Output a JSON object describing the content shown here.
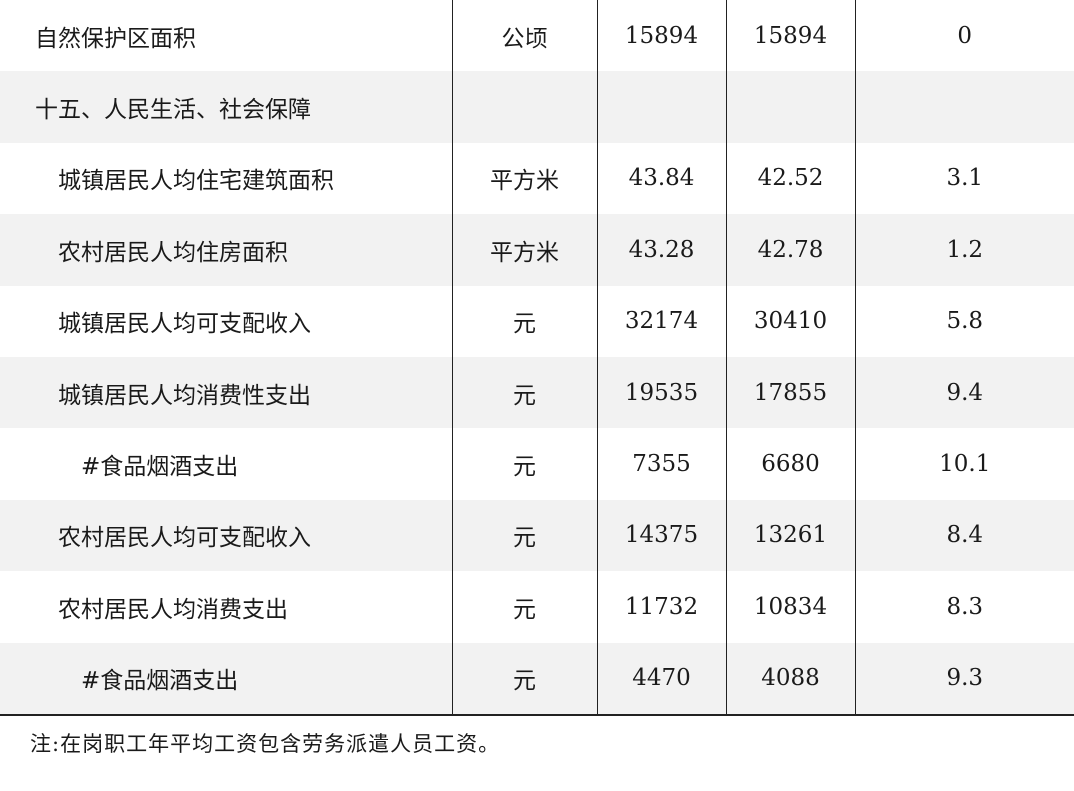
{
  "table": {
    "rows": [
      {
        "name": "自然保护区面积",
        "unit": "公顷",
        "v1": "15894",
        "v2": "15894",
        "v3": "0",
        "level": 0
      },
      {
        "name": "十五、人民生活、社会保障",
        "unit": "",
        "v1": "",
        "v2": "",
        "v3": "",
        "level": 0
      },
      {
        "name": "城镇居民人均住宅建筑面积",
        "unit": "平方米",
        "v1": "43.84",
        "v2": "42.52",
        "v3": "3.1",
        "level": 1
      },
      {
        "name": "农村居民人均住房面积",
        "unit": "平方米",
        "v1": "43.28",
        "v2": "42.78",
        "v3": "1.2",
        "level": 1
      },
      {
        "name": "城镇居民人均可支配收入",
        "unit": "元",
        "v1": "32174",
        "v2": "30410",
        "v3": "5.8",
        "level": 1
      },
      {
        "name": "城镇居民人均消费性支出",
        "unit": "元",
        "v1": "19535",
        "v2": "17855",
        "v3": "9.4",
        "level": 1
      },
      {
        "name": "#食品烟酒支出",
        "unit": "元",
        "v1": "7355",
        "v2": "6680",
        "v3": "10.1",
        "level": 2
      },
      {
        "name": "农村居民人均可支配收入",
        "unit": "元",
        "v1": "14375",
        "v2": "13261",
        "v3": "8.4",
        "level": 1
      },
      {
        "name": "农村居民人均消费支出",
        "unit": "元",
        "v1": "11732",
        "v2": "10834",
        "v3": "8.3",
        "level": 1
      },
      {
        "name": "#食品烟酒支出",
        "unit": "元",
        "v1": "4470",
        "v2": "4088",
        "v3": "9.3",
        "level": 2
      }
    ]
  },
  "note": "注:在岗职工年平均工资包含劳务派遣人员工资。"
}
